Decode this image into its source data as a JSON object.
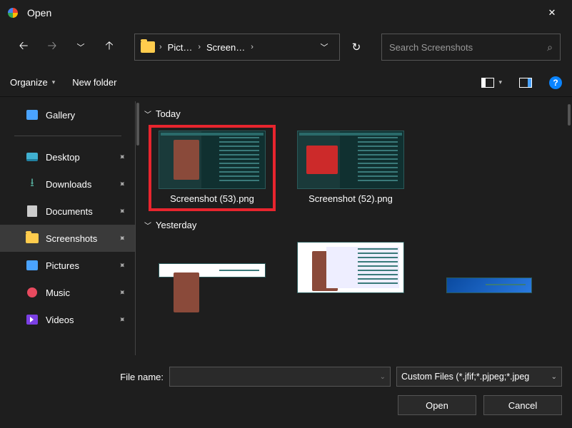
{
  "window": {
    "title": "Open"
  },
  "nav": {
    "breadcrumb": [
      "Pict…",
      "Screen…"
    ],
    "search_placeholder": "Search Screenshots"
  },
  "toolbar": {
    "organize": "Organize",
    "newfolder": "New folder"
  },
  "sidebar": {
    "gallery": "Gallery",
    "items": [
      {
        "label": "Desktop"
      },
      {
        "label": "Downloads"
      },
      {
        "label": "Documents"
      },
      {
        "label": "Screenshots"
      },
      {
        "label": "Pictures"
      },
      {
        "label": "Music"
      },
      {
        "label": "Videos"
      }
    ]
  },
  "groups": {
    "today": "Today",
    "yesterday": "Yesterday"
  },
  "files": {
    "today": [
      {
        "name": "Screenshot (53).png",
        "selected": true
      },
      {
        "name": "Screenshot (52).png",
        "selected": false
      }
    ]
  },
  "bottom": {
    "filename_label": "File name:",
    "filename_value": "",
    "filetype": "Custom Files (*.jfif;*.pjpeg;*.jpeg",
    "open": "Open",
    "cancel": "Cancel"
  }
}
